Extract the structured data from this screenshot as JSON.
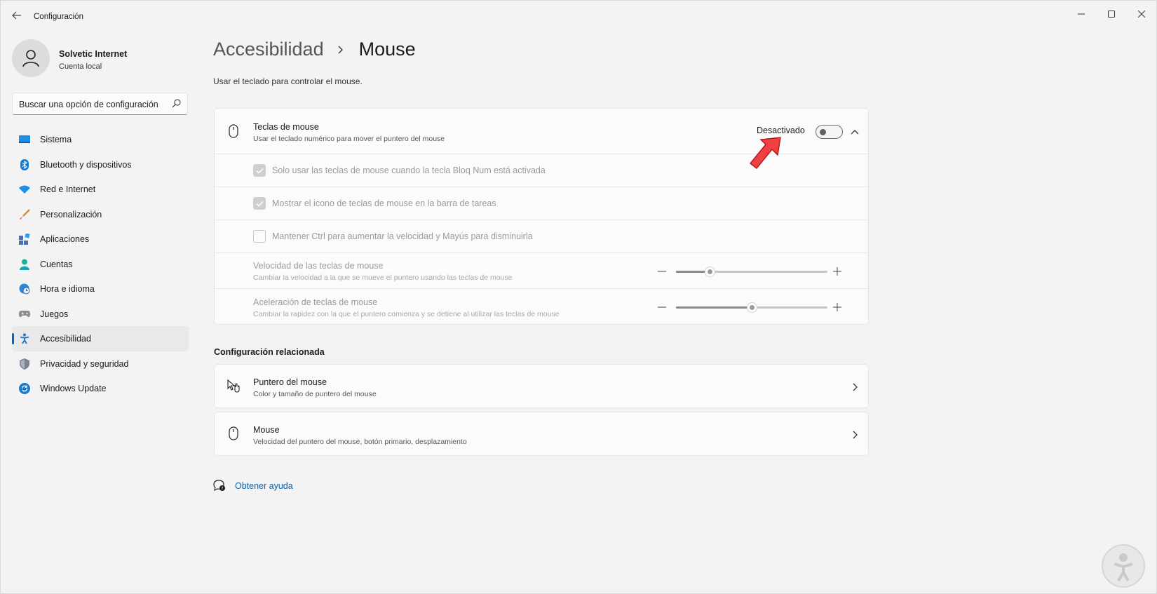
{
  "window": {
    "title": "Configuración"
  },
  "profile": {
    "name": "Solvetic Internet",
    "account_type": "Cuenta local"
  },
  "search": {
    "placeholder": "Buscar una opción de configuración"
  },
  "sidebar": {
    "items": [
      {
        "label": "Sistema",
        "icon": "system-icon"
      },
      {
        "label": "Bluetooth y dispositivos",
        "icon": "bluetooth-icon"
      },
      {
        "label": "Red e Internet",
        "icon": "wifi-icon"
      },
      {
        "label": "Personalización",
        "icon": "brush-icon"
      },
      {
        "label": "Aplicaciones",
        "icon": "apps-icon"
      },
      {
        "label": "Cuentas",
        "icon": "account-icon"
      },
      {
        "label": "Hora e idioma",
        "icon": "globe-clock-icon"
      },
      {
        "label": "Juegos",
        "icon": "gamepad-icon"
      },
      {
        "label": "Accesibilidad",
        "icon": "accessibility-icon",
        "selected": true
      },
      {
        "label": "Privacidad y seguridad",
        "icon": "shield-icon"
      },
      {
        "label": "Windows Update",
        "icon": "update-icon"
      }
    ]
  },
  "header": {
    "breadcrumb_parent": "Accesibilidad",
    "breadcrumb_current": "Mouse",
    "subtitle": "Usar el teclado para controlar el mouse."
  },
  "mouse_keys": {
    "title": "Teclas de mouse",
    "description": "Usar el teclado numérico para mover el puntero del mouse",
    "toggle_state": "Desactivado",
    "toggle_on": false,
    "options": [
      {
        "label": "Solo usar las teclas de mouse cuando la tecla Bloq Num está activada",
        "checked": true
      },
      {
        "label": "Mostrar el icono de teclas de mouse en la barra de tareas",
        "checked": true
      },
      {
        "label": "Mantener Ctrl para aumentar la velocidad y Mayús para disminuirla",
        "checked": false
      }
    ],
    "speed": {
      "title": "Velocidad de las teclas de mouse",
      "description": "Cambiar la velocidad a la que se mueve el puntero usando las teclas de mouse",
      "value_fraction": 0.22
    },
    "acceleration": {
      "title": "Aceleración de teclas de mouse",
      "description": "Cambiar la rapidez con la que el puntero comienza y se detiene al utilizar las teclas de mouse",
      "value_fraction": 0.5
    }
  },
  "related": {
    "title": "Configuración relacionada",
    "items": [
      {
        "title": "Puntero del mouse",
        "description": "Color y tamaño de puntero del mouse",
        "icon": "pointer-icon"
      },
      {
        "title": "Mouse",
        "description": "Velocidad del puntero del mouse, botón primario, desplazamiento",
        "icon": "mouse-icon"
      }
    ]
  },
  "help": {
    "label": "Obtener ayuda"
  },
  "colors": {
    "accent": "#0067c0",
    "annotation_arrow": "#f04040",
    "link": "#0b5fa8"
  }
}
